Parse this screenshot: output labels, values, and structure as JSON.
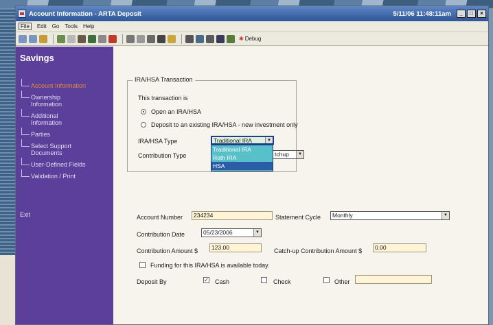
{
  "window": {
    "title": "Account Information - ARTA Deposit",
    "clock": "5/11/06 11:48:11am",
    "controls": [
      "_",
      "□",
      "×"
    ]
  },
  "menu": [
    "File",
    "Edit",
    "Go",
    "Tools",
    "Help"
  ],
  "toolbar": {
    "debug_label": "Debug"
  },
  "sidebar": {
    "title": "Savings",
    "items": [
      "Account Information",
      "Ownership Information",
      "Additional Information",
      "Parties",
      "Select Support Documents",
      "User-Defined Fields",
      "Validation / Print"
    ],
    "exit": "Exit"
  },
  "transaction": {
    "legend": "IRA/HSA Transaction",
    "prompt": "This transaction is",
    "option_open": "Open an IRA/HSA",
    "option_deposit": "Deposit to an existing IRA/HSA - new investment only",
    "type_label": "IRA/HSA Type",
    "type_value": "Traditional IRA",
    "type_options": [
      "Traditional IRA",
      "Roth IRA",
      "HSA"
    ],
    "contribution_type_label": "Contribution Type",
    "contribution_type_value": "tchup"
  },
  "form": {
    "account_number_label": "Account Number",
    "account_number": "234234",
    "statement_cycle_label": "Statement Cycle",
    "statement_cycle": "Monthly",
    "contribution_date_label": "Contribution Date",
    "contribution_date": "05/23/2006",
    "contribution_amount_label": "Contribution Amount $",
    "contribution_amount": "123.00",
    "catchup_label": "Catch-up Contribution Amount $",
    "catchup_amount": "0.00",
    "funding_label": "Funding for this IRA/HSA is available today.",
    "deposit_by_label": "Deposit By",
    "cash_label": "Cash",
    "check_label": "Check",
    "other_label": "Other"
  }
}
